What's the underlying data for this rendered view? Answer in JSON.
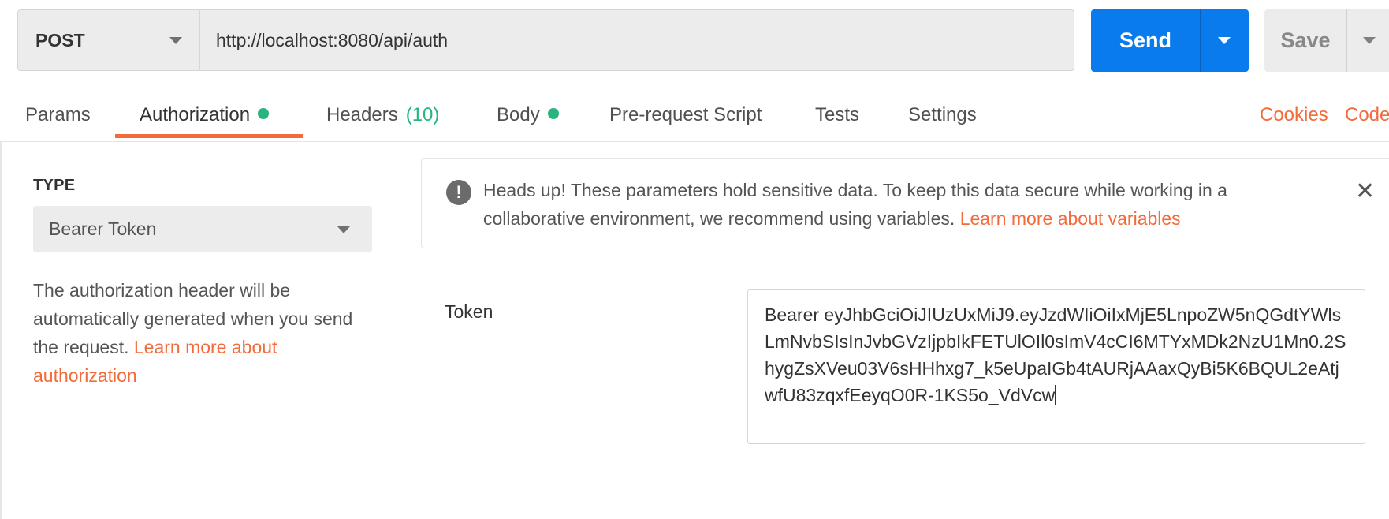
{
  "request": {
    "method": "POST",
    "url": "http://localhost:8080/api/auth",
    "send_label": "Send",
    "save_label": "Save"
  },
  "tabs": [
    {
      "label": "Params"
    },
    {
      "label": "Authorization",
      "has_dot": true,
      "active": true
    },
    {
      "label": "Headers",
      "count": "(10)"
    },
    {
      "label": "Body",
      "has_dot": true
    },
    {
      "label": "Pre-request Script"
    },
    {
      "label": "Tests"
    },
    {
      "label": "Settings"
    }
  ],
  "tab_links": {
    "cookies": "Cookies",
    "code": "Code"
  },
  "auth": {
    "type_label": "TYPE",
    "type_value": "Bearer Token",
    "help_text": "The authorization header will be automatically generated when you send the request.",
    "help_link": "Learn more about authorization"
  },
  "alert": {
    "message": "Heads up! These parameters hold sensitive data. To keep this data secure while working in a collaborative environment, we recommend using variables.",
    "link": "Learn more about variables"
  },
  "token": {
    "label": "Token",
    "value": "Bearer eyJhbGciOiJIUzUxMiJ9.eyJzdWIiOiIxMjE5LnpoZW5nQGdtYWlsLmNvbSIsInJvbGVzIjpbIkFETUlOIl0sImV4cCI6MTYxMDk2NzU1Mn0.2ShygZsXVeu03V6sHHhxg7_k5eUpaIGb4tAURjAAaxQyBi5K6BQUL2eAtjwfU83zqxfEeyqO0R-1KS5o_VdVcw"
  },
  "colors": {
    "accent_orange": "#f26b3a",
    "send_blue": "#097bed",
    "status_green": "#26b47f"
  }
}
